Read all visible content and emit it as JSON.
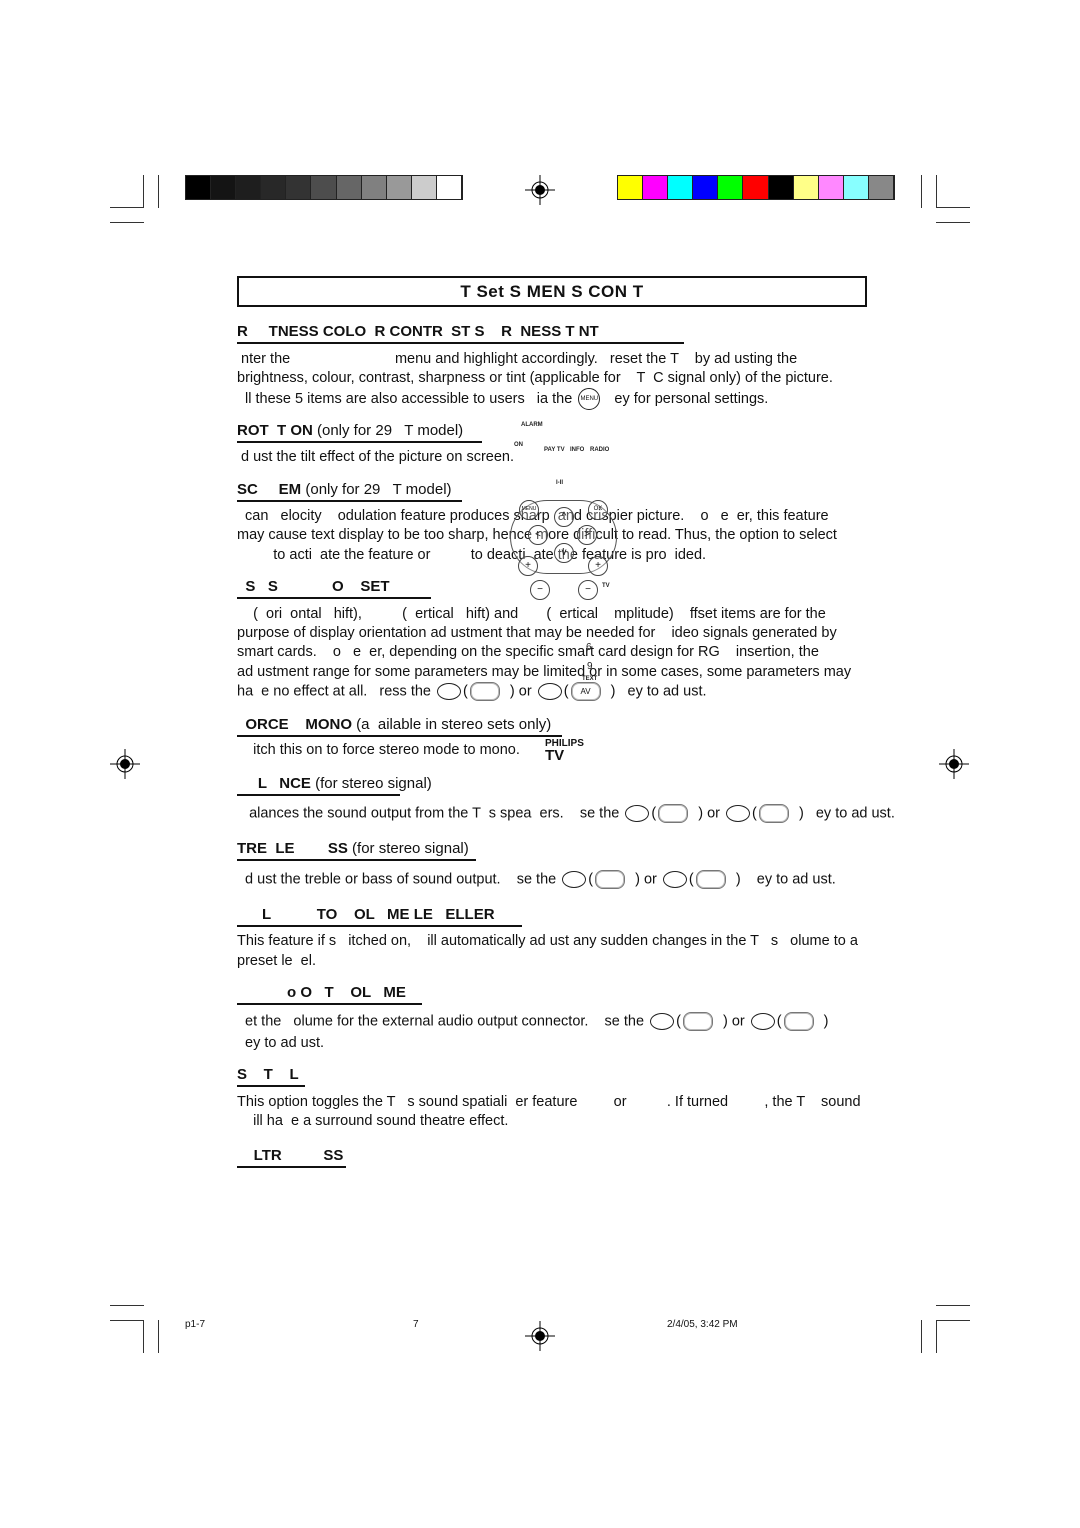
{
  "print_marks": {
    "gray_bar": [
      "#000000",
      "#141414",
      "#1e1e1e",
      "#282828",
      "#333333",
      "#4d4d4d",
      "#666666",
      "#808080",
      "#999999",
      "#cccccc",
      "#ffffff"
    ],
    "color_bar": [
      "#ffff00",
      "#ff00ff",
      "#00ffff",
      "#0000ff",
      "#00ff00",
      "#ff0000",
      "#000000",
      "#ffff88",
      "#ff88ff",
      "#88ffff",
      "#888888"
    ]
  },
  "title": "T   Set    S    MEN  S   CON T",
  "sections": [
    {
      "heading": "R     TNESS COLO  R CONTR  ST S    R  NESS T NT",
      "note": "",
      "lines": [
        [
          " nter the                          menu and highlight accordingly.   reset the T    by ad usting the"
        ],
        [
          "brightness, colour, contrast, sharpness or tint (applicable for    T  C signal only) of the picture."
        ],
        [
          "  ll these 5 items are also accessible to users   ia the ",
          "   ey for personal settings."
        ]
      ]
    },
    {
      "heading": "ROT  T ON",
      "note": " (only for 29   T model)",
      "lines": [
        [
          " d ust the tilt effect of the picture on screen."
        ]
      ]
    },
    {
      "heading": "SC     EM",
      "note": " (only for 29   T model)",
      "lines": [
        [
          "  can   elocity    odulation feature produces sharp  and crispier picture.    o   e  er, this feature"
        ],
        [
          "may cause text display to be too sharp, hence more difficult to read. Thus, the option to select"
        ],
        [
          "         to acti  ate the feature or          to deacti  ate the feature is pro  ided."
        ]
      ]
    },
    {
      "heading": "  S   S             O    SET",
      "note": "",
      "lines": [
        [
          "    (  ori  ontal   hift),          (  ertical   hift) and       (  ertical    mplitude)    ffset items are for the"
        ],
        [
          "purpose of display orientation ad ustment that may be needed for    ideo signals generated by"
        ],
        [
          "smart cards.    o   e  er, depending on the specific smart card design for RG    insertion, the"
        ],
        [
          "ad ustment range for some parameters may be limited or in some cases, some parameters may"
        ],
        [
          "ha  e no effect at all.   ress the ",
          "(",
          "  ) or ",
          "(",
          "  )   ey to ad ust."
        ]
      ]
    },
    {
      "heading": "  ORCE    MONO",
      "note": " (a  ailable in stereo sets only)",
      "lines": [
        [
          "    itch this on to force stereo mode to mono."
        ]
      ]
    },
    {
      "heading": "     L   NCE",
      "note": " (for stereo signal)",
      "lines": [
        [
          "   alances the sound output from the T  s spea  ers.    se the ",
          "(",
          "  ) or ",
          "(",
          "  )   ey to ad ust."
        ]
      ]
    },
    {
      "heading": "TRE  LE        SS",
      "note": " (for stereo signal)",
      "lines": [
        [
          "  d ust the treble or bass of sound output.    se the ",
          "(",
          "  ) or ",
          "(",
          "  )    ey to ad ust."
        ]
      ]
    },
    {
      "heading": "      L           TO    OL   ME LE   ELLER",
      "note": "",
      "lines": [
        [
          "This feature if s   itched on,    ill automatically ad ust any sudden changes in the T   s   olume to a"
        ],
        [
          "preset le  el."
        ]
      ]
    },
    {
      "heading": "            o O   T    OL   ME",
      "note": "",
      "lines": [
        [
          "  et the   olume for the external audio output connector.    se the ",
          "(",
          "  ) or ",
          "(",
          "  )"
        ],
        [
          "  ey to ad ust."
        ]
      ]
    },
    {
      "heading": "S    T    L",
      "note": "",
      "lines": [
        [
          "This option toggles the T   s sound spatiali  er feature         or          . If turned         , the T    sound"
        ],
        [
          "    ill ha  e a surround sound theatre effect."
        ]
      ]
    },
    {
      "heading": "    LTR          SS",
      "note": "",
      "lines": []
    }
  ],
  "remote_labels": {
    "alarm": "ALARM",
    "on": "ON",
    "pay_tv": "PAY TV",
    "info": "INFO",
    "radio": "RADIO",
    "menu": "MENU",
    "ok": "OK",
    "tv": "TV",
    "text": "TEXT",
    "av": "AV",
    "six": "6",
    "nine": "9",
    "menu_key": "MENU",
    "roman": "I-II"
  },
  "logo": {
    "brand": "PHILIPS",
    "product": "TV"
  },
  "footer": {
    "file": "p1-7",
    "page": "7",
    "timestamp": "2/4/05, 3:42 PM"
  }
}
